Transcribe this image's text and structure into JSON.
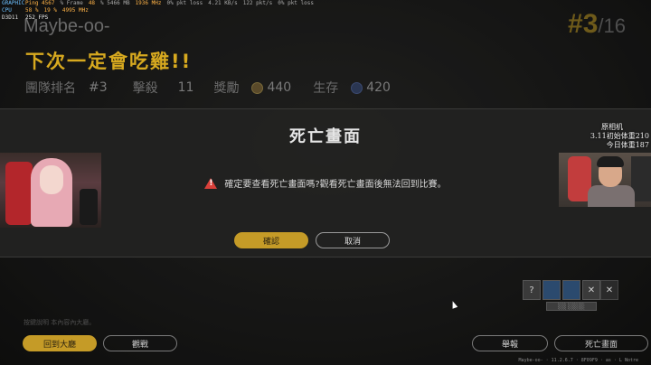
{
  "overlay_stats": {
    "rows": [
      {
        "label": "GRAPHIC",
        "values": [
          "Ping 4567",
          "% Frame",
          "48",
          "% 5466 MB",
          "1936 MHz",
          "0% pkt loss",
          "4.21 KB/s",
          "122 pkt/s",
          "0% pkt loss"
        ]
      },
      {
        "label": "CPU",
        "values": [
          "58 %",
          "19 %",
          "4995 MHz"
        ]
      },
      {
        "label": "D3D11",
        "values": [
          "252 FPS"
        ]
      }
    ]
  },
  "player_name": "Maybe-oo-",
  "headline": "下次一定會吃雞!!",
  "summary": {
    "team_rank_label": "團隊排名",
    "team_rank": "#3",
    "kills_label": "擊殺",
    "kills": "11",
    "reward_label": "獎勵",
    "reward": "440",
    "survival_label": "生存",
    "survival": "420"
  },
  "rank": {
    "place": "#3",
    "total": "/16"
  },
  "dialog": {
    "title": "死亡畫面",
    "message": "確定要查看死亡畫面嗎?觀看死亡畫面後無法回到比賽。",
    "confirm_label": "確認",
    "cancel_label": "取消",
    "warning_icon": "warning-triangle-icon",
    "warning_color": "#d9403a"
  },
  "weight_panel": {
    "title": "原相机",
    "line1": "3.11初始体重210",
    "line2": "今日体重187"
  },
  "hint_text": "按鍵說明 本內容內大廳。",
  "buttons": {
    "lobby": "回到大廳",
    "spectate": "觀戰",
    "report": "舉報",
    "deathcam": "死亡畫面"
  },
  "inventory": {
    "slot1": "?",
    "slot4": "✕",
    "slot5": "✕",
    "bar_label": "░░ ░░░░"
  },
  "footer": "Maybe-oo- · 11.2.6.7 · 8F09F9 · as · L Notre",
  "colors": {
    "accent": "#c59b27",
    "headline": "#d7a91f"
  }
}
